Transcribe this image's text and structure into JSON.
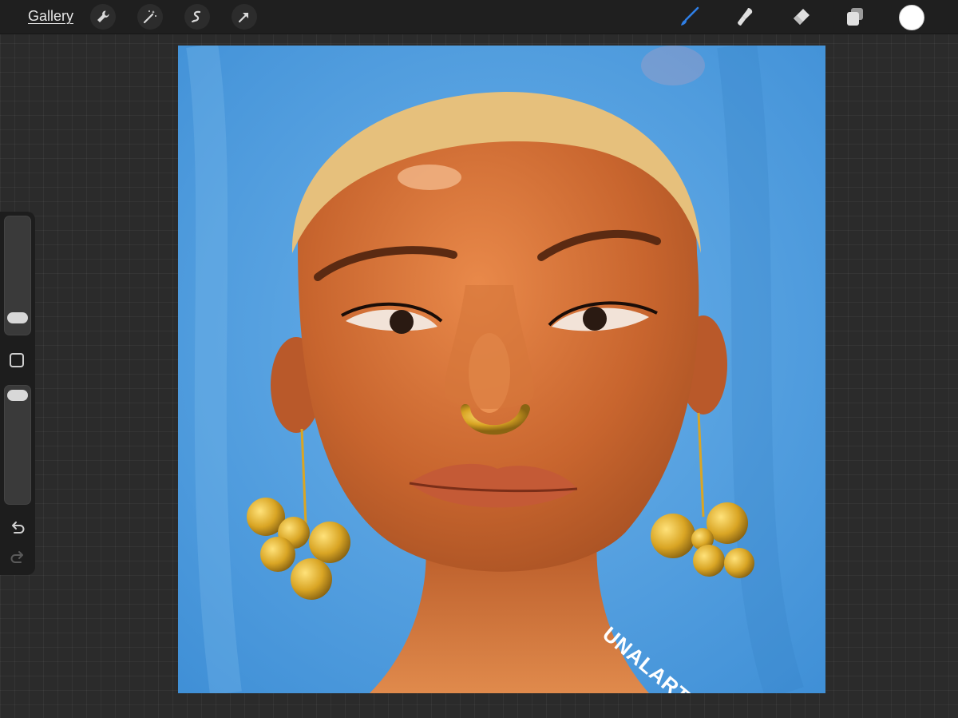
{
  "topbar": {
    "gallery_label": "Gallery",
    "left_tools": [
      "wrench-icon",
      "magic-wand-icon",
      "selection-icon",
      "transform-arrow-icon"
    ],
    "right_tools": [
      "brush-icon",
      "smudge-icon",
      "eraser-icon",
      "layers-icon"
    ],
    "active_tool": "brush-icon",
    "accent_color": "#2f7fe6",
    "current_color": "#ffffff"
  },
  "sidebar": {
    "brush_size_level": 0.18,
    "opacity_level": 0.92,
    "tools": [
      "modify-button",
      "undo-icon",
      "redo-icon"
    ]
  },
  "canvas": {
    "signature": "UNALART",
    "background_color": "#4f9fe0"
  }
}
